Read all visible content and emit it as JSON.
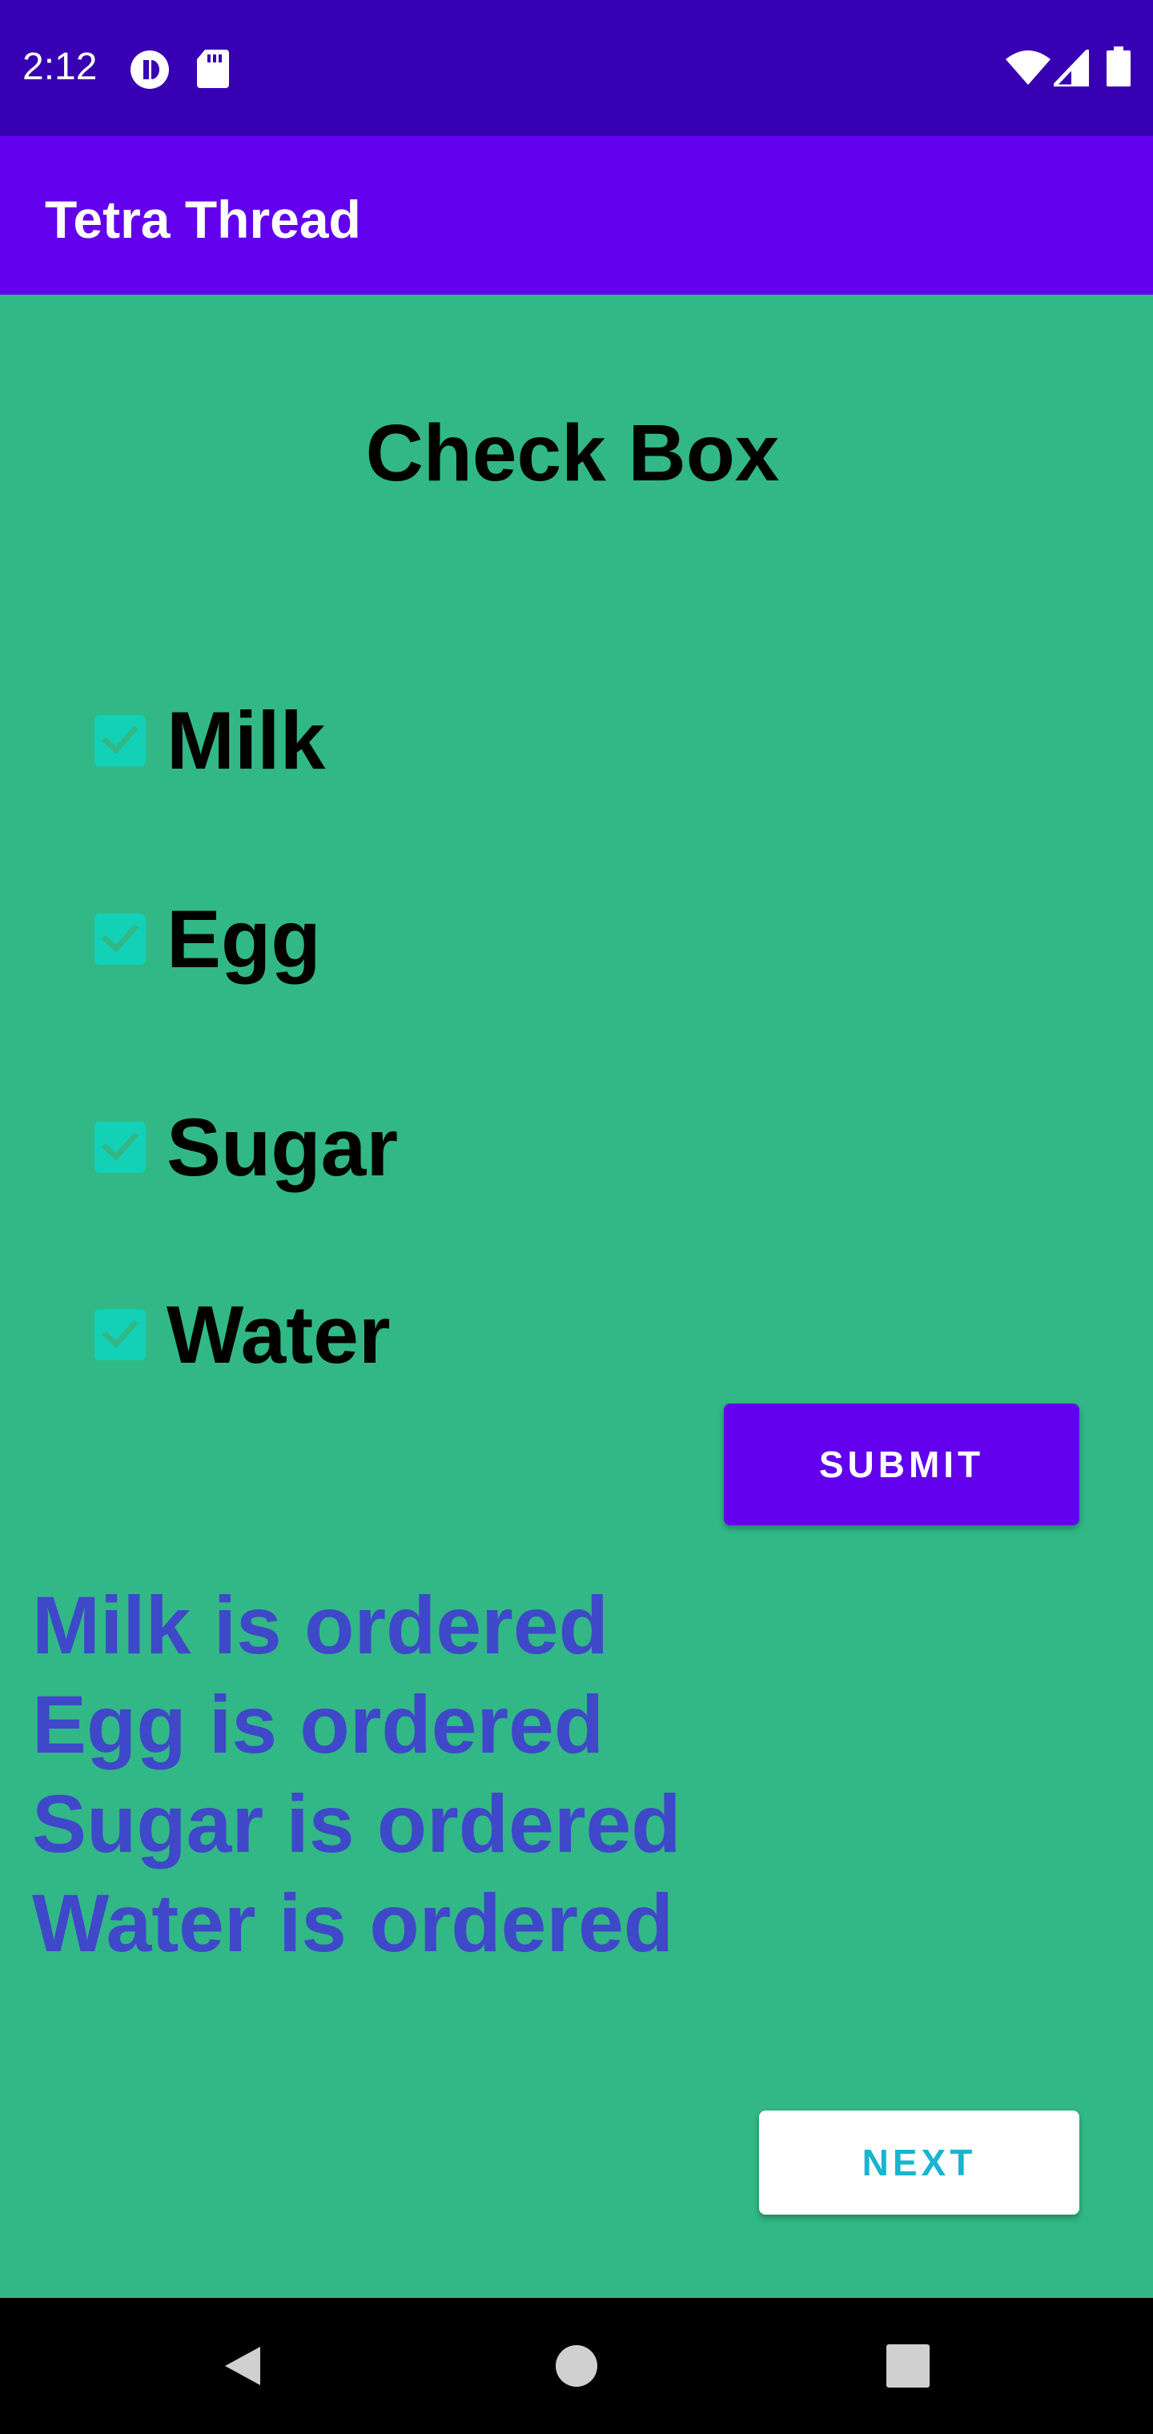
{
  "status_bar": {
    "time": "2:12",
    "icons": [
      "notification-icon",
      "sd-card-icon",
      "wifi-icon",
      "signal-icon",
      "battery-icon"
    ]
  },
  "app_bar": {
    "title": "Tetra Thread"
  },
  "main": {
    "heading": "Check Box",
    "checkboxes": [
      {
        "label": "Milk",
        "checked": true
      },
      {
        "label": "Egg",
        "checked": true
      },
      {
        "label": "Sugar",
        "checked": true
      },
      {
        "label": "Water",
        "checked": true
      }
    ],
    "submit_label": "SUBMIT",
    "orders": [
      "Milk is ordered",
      "Egg is ordered",
      "Sugar is ordered",
      "Water is ordered"
    ],
    "next_label": "NEXT"
  },
  "nav_bar": {
    "buttons": [
      "back-icon",
      "home-icon",
      "recents-icon"
    ]
  },
  "colors": {
    "status_bar": "#3700b3",
    "app_bar": "#6200ee",
    "background": "#31b886",
    "checkbox": "#13d1b7",
    "order_text": "#3f48c8",
    "next_text": "#18b4d0"
  }
}
